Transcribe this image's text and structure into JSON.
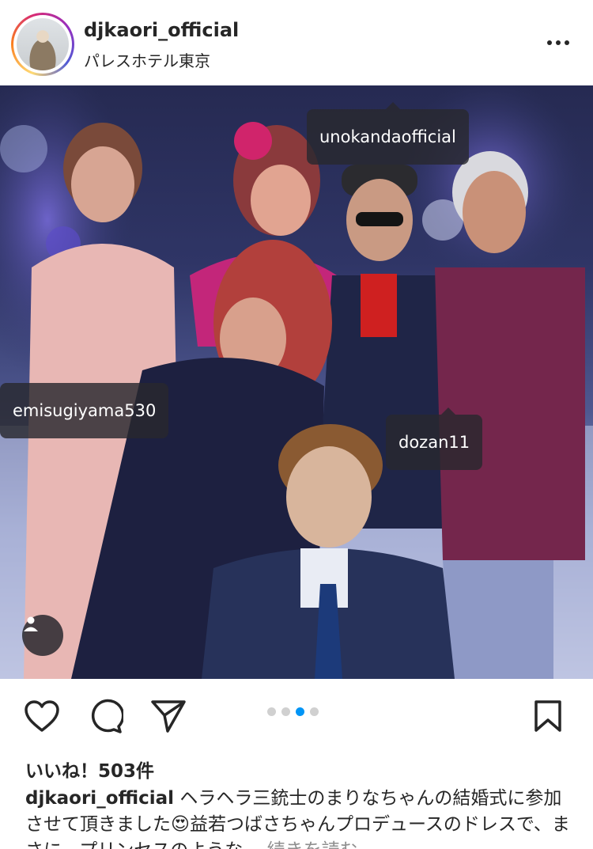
{
  "header": {
    "username": "djkaori_official",
    "location": "パレスホテル東京"
  },
  "photo": {
    "tags": {
      "tag1": "unokandaofficial",
      "tag2": "emisugiyama530",
      "tag3": "dozan11"
    },
    "carousel": {
      "total": 4,
      "active_index": 3
    }
  },
  "post": {
    "likes": "いいね！503件",
    "caption_user": "djkaori_official",
    "caption_text": "ヘラヘラ三銃士のまりなちゃんの結婚式に参加させて頂きました😍益若つばさちゃんプロデュースのドレスで、まさに、プリンセスのような…",
    "more": "続きを読む"
  },
  "icons": {
    "like": "heart-icon",
    "comment": "comment-icon",
    "share": "send-icon",
    "save": "bookmark-icon",
    "tagged": "person-icon",
    "options": "more-icon"
  },
  "colors": {
    "accent": "#0095f6",
    "tag_bg": "#28282e"
  }
}
